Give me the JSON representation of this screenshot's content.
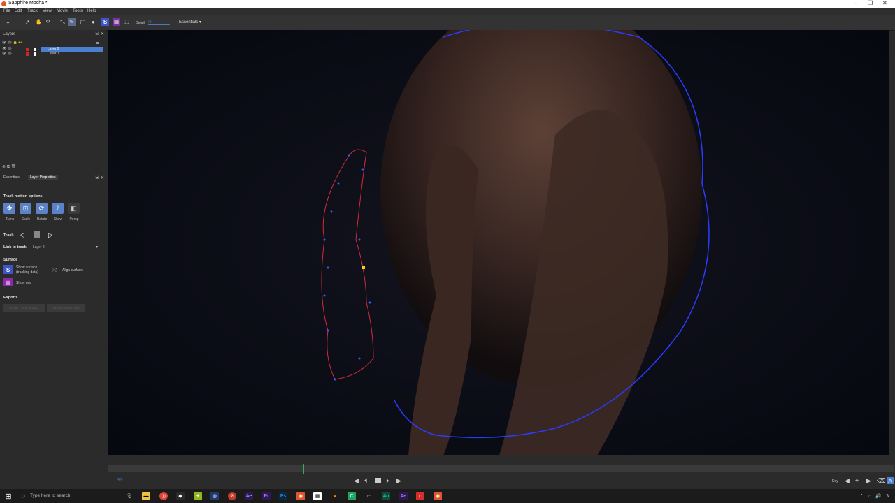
{
  "window": {
    "title": "Sapphire Mocha *",
    "controls": [
      "–",
      "❐",
      "✕"
    ]
  },
  "menu": [
    "File",
    "Edit",
    "Track",
    "View",
    "Movie",
    "Tools",
    "Help"
  ],
  "toolbar": {
    "detail_label": "Detail",
    "detail_value": "90",
    "workspace": "Essentials"
  },
  "layers_panel": {
    "title": "Layers",
    "layers": [
      {
        "name": "Layer 2",
        "selected": true,
        "color": "#cc2a2a"
      },
      {
        "name": "Layer 1",
        "selected": false,
        "color": "#cc2a2a"
      }
    ]
  },
  "tabs": [
    "Essentials",
    "Layer Properties"
  ],
  "properties": {
    "track_motion_title": "Track motion options",
    "motion_options": [
      {
        "label": "Trans",
        "on": true
      },
      {
        "label": "Scale",
        "on": true
      },
      {
        "label": "Rotate",
        "on": true
      },
      {
        "label": "Skew",
        "on": true
      },
      {
        "label": "Persp",
        "on": false
      }
    ],
    "track_label": "Track",
    "link_label": "Link to track",
    "link_value": "Layer 2",
    "surface_title": "Surface",
    "show_surface_label": "Show surface",
    "show_surface_sub": "(tracking data)",
    "align_surface_label": "Align surface",
    "show_grid_label": "Show grid",
    "exports_title": "Exports",
    "export_buttons": [
      "Export Tracking Data",
      "Export Shape Data"
    ]
  },
  "timeline": {
    "frame": "53",
    "key_label": "Key"
  },
  "taskbar": {
    "search_placeholder": "Type here to search"
  },
  "colors": {
    "accent": "#4b7fd0",
    "spline_blue": "#2a3cff",
    "spline_red": "#d42a3a",
    "toggle_on": "#5b82c6"
  }
}
